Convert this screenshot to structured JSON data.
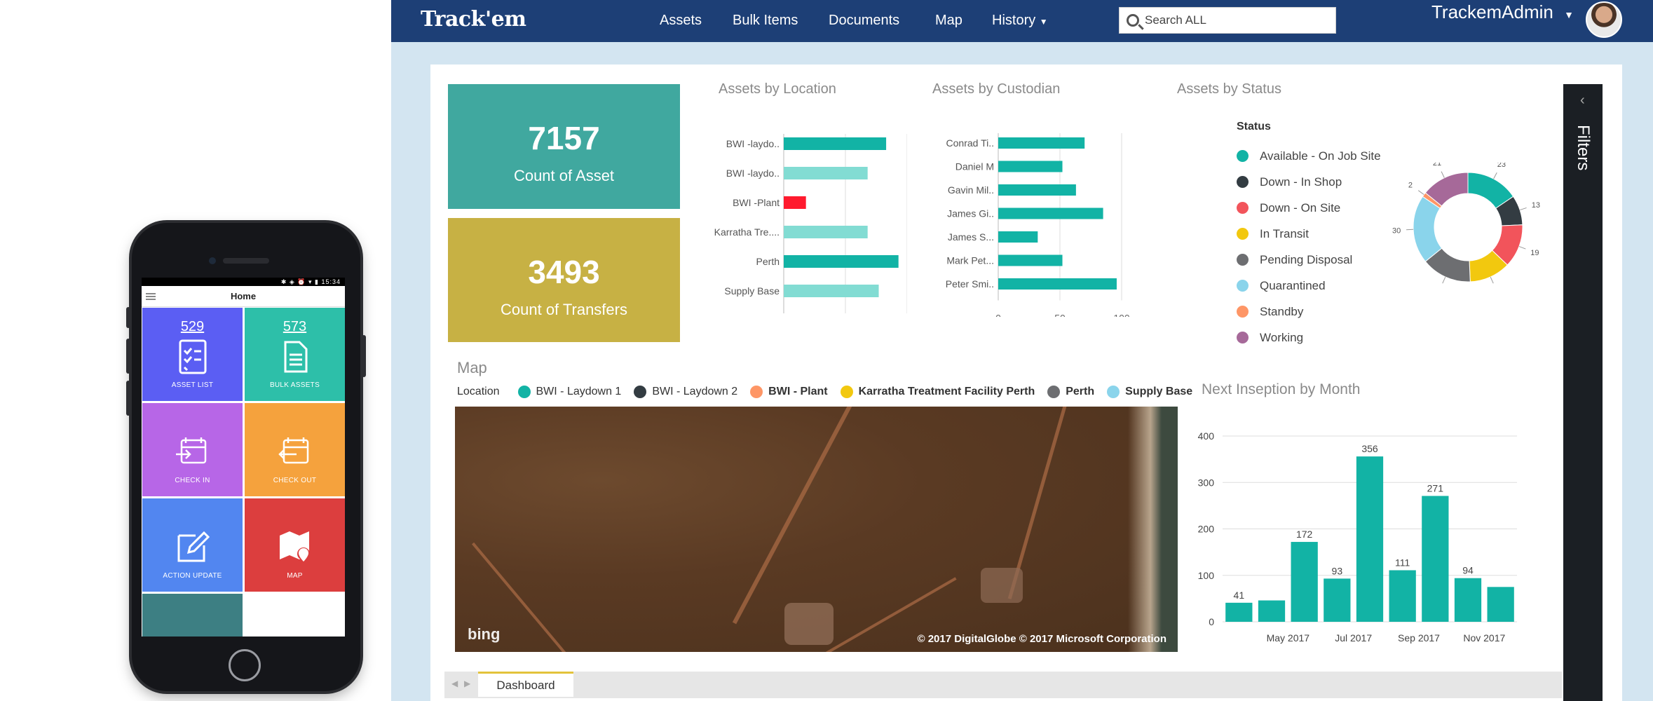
{
  "phone": {
    "status_time": "15:34",
    "header_title": "Home",
    "tiles": [
      {
        "count": "529",
        "label": "ASSET LIST",
        "color": "#5b5ef3",
        "icon": "checklist-icon"
      },
      {
        "count": "573",
        "label": "BULK ASSETS",
        "color": "#2dbfa9",
        "icon": "documents-icon"
      },
      {
        "count": "",
        "label": "CHECK IN",
        "color": "#b766e7",
        "icon": "calendar-checkin-icon"
      },
      {
        "count": "",
        "label": "CHECK OUT",
        "color": "#f5a23d",
        "icon": "calendar-checkout-icon"
      },
      {
        "count": "",
        "label": "ACTION UPDATE",
        "color": "#5286f0",
        "icon": "edit-icon"
      },
      {
        "count": "",
        "label": "MAP",
        "color": "#dc3e3e",
        "icon": "map-pin-icon"
      },
      {
        "count": "",
        "label": "",
        "color": "#3d7f83",
        "icon": "cart-icon"
      }
    ]
  },
  "nav": {
    "logo": "Track'em",
    "items": [
      "Assets",
      "Bulk Items",
      "Documents",
      "Map",
      "History"
    ],
    "search_placeholder": "Search ALL",
    "user": "TrackemAdmin"
  },
  "kpis": [
    {
      "value": "7157",
      "label": "Count of Asset",
      "color": "#40a89f"
    },
    {
      "value": "3493",
      "label": "Count of Transfers",
      "color": "#c7b144"
    }
  ],
  "chart_data": [
    {
      "type": "bar",
      "orientation": "horizontal",
      "title": "Assets by Location",
      "categories": [
        "BWI -laydo..",
        "BWI -laydo..",
        "BWI -Plant",
        "Karratha Tre....",
        "Perth",
        "Supply Base"
      ],
      "values": [
        83,
        68,
        18,
        68,
        93,
        77
      ],
      "highlight_index": 2,
      "highlight_color": "#ff1a2e",
      "xticks": [
        "0",
        "50",
        "100"
      ],
      "xlim": [
        0,
        100
      ]
    },
    {
      "type": "bar",
      "orientation": "horizontal",
      "title": "Assets by Custodian",
      "categories": [
        "Conrad Ti..",
        "Daniel M",
        "Gavin Mil..",
        "James Gi..",
        "James S...",
        "Mark Pet...",
        "Peter Smi.."
      ],
      "values": [
        70,
        52,
        63,
        85,
        32,
        52,
        96
      ],
      "xticks": [
        "0",
        "50",
        "100"
      ],
      "xlim": [
        0,
        100
      ]
    },
    {
      "type": "pie",
      "title": "Assets by Status",
      "legend_title": "Status",
      "labels": [
        "Available - On Job Site",
        "Down - In Shop",
        "Down - On Site",
        "In Transit",
        "Pending Disposal",
        "Quarantined",
        "Standby",
        "Working"
      ],
      "values": [
        23,
        13,
        19,
        18,
        22,
        30,
        2,
        21
      ],
      "colors": [
        "#12b3a5",
        "#333c42",
        "#f2545b",
        "#f2c80f",
        "#6d6e71",
        "#8ad4eb",
        "#fe9666",
        "#a66999"
      ]
    },
    {
      "type": "bar",
      "title": "Next Inseption by Month",
      "categories": [
        "Apr 2017",
        "May 2017",
        "Jun 2017",
        "Jul 2017",
        "Aug 2017",
        "Sep 2017",
        "Oct 2017",
        "Nov 2017",
        "Dec 2017"
      ],
      "xtick_labels": [
        "May 2017",
        "Jul 2017",
        "Sep 2017",
        "Nov 2017"
      ],
      "values": [
        41,
        46,
        172,
        93,
        356,
        111,
        271,
        94,
        75
      ],
      "data_labels": [
        "41",
        "",
        "172",
        "93",
        "356",
        "111",
        "271",
        "94",
        ""
      ],
      "yticks": [
        "0",
        "100",
        "200",
        "300",
        "400"
      ],
      "ylim": [
        0,
        400
      ]
    }
  ],
  "map": {
    "title": "Map",
    "legend_title": "Location",
    "legend": [
      {
        "name": "BWI - Laydown 1",
        "color": "#12b3a5",
        "bold": false
      },
      {
        "name": "BWI - Laydown 2",
        "color": "#333c42",
        "bold": false
      },
      {
        "name": "BWI - Plant",
        "color": "#fe9666",
        "bold": true
      },
      {
        "name": "Karratha Treatment Facility Perth",
        "color": "#f2c80f",
        "bold": true
      },
      {
        "name": "Perth",
        "color": "#6d6e71",
        "bold": true
      },
      {
        "name": "Supply Base",
        "color": "#8ad4eb",
        "bold": true
      }
    ],
    "bing": "bing",
    "copyright": "© 2017 DigitalGlobe   © 2017 Microsoft Corporation"
  },
  "filters": "Filters",
  "tab": "Dashboard"
}
